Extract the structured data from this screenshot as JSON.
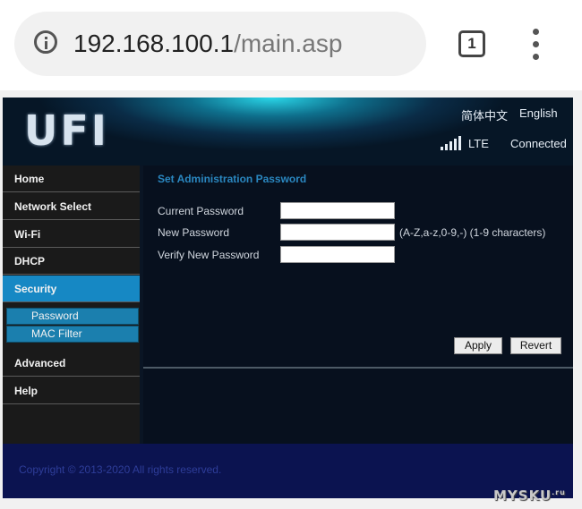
{
  "browser": {
    "url_host": "192.168.100.1",
    "url_path": "/main.asp",
    "tab_count": "1",
    "icons": {
      "info": "info-icon",
      "menu": "more-vert-icon"
    }
  },
  "router": {
    "logo": "UFI",
    "lang_cn": "简体中文",
    "lang_en": "English",
    "network_type": "LTE",
    "status": "Connected",
    "signal_icon": "signal-bars-icon"
  },
  "sidebar": {
    "items": [
      {
        "label": "Home"
      },
      {
        "label": "Network Select"
      },
      {
        "label": "Wi-Fi"
      },
      {
        "label": "DHCP"
      },
      {
        "label": "Security",
        "active": true
      },
      {
        "label": "Advanced"
      },
      {
        "label": "Help"
      }
    ],
    "subitems": [
      {
        "label": "Password",
        "active": true
      },
      {
        "label": "MAC Filter"
      }
    ]
  },
  "form": {
    "title": "Set Administration Password",
    "current_label": "Current Password",
    "current_value": "",
    "new_label": "New Password",
    "new_value": "",
    "verify_label": "Verify New Password",
    "verify_value": "",
    "hint": "(A-Z,a-z,0-9,-) (1-9 characters)",
    "apply": "Apply",
    "revert": "Revert"
  },
  "footer": {
    "copyright": "Copyright © 2013-2020 All rights reserved."
  },
  "watermark": {
    "text": "MYSKU",
    "suffix": ".ru"
  },
  "colors": {
    "accent": "#1688c4",
    "title": "#2a87c0",
    "footer_bg": "#0b1350"
  }
}
